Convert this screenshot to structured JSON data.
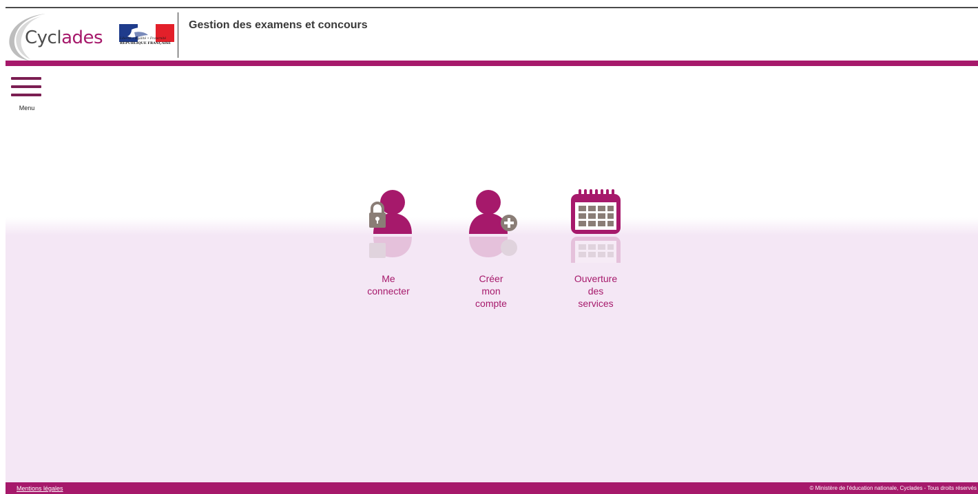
{
  "header": {
    "logo_prefix": "Cycl",
    "logo_accent": "ades",
    "motto": "Liberté • Égalité • Fraternité",
    "republic": "RÉPUBLIQUE FRANÇAISE",
    "app_title": "Gestion des examens et concours"
  },
  "menu": {
    "label": "Menu"
  },
  "tiles": [
    {
      "label_lines": [
        "Me",
        "connecter"
      ],
      "icon": "user-lock-icon"
    },
    {
      "label_lines": [
        "Créer",
        "mon",
        "compte"
      ],
      "icon": "user-add-icon"
    },
    {
      "label_lines": [
        "Ouverture",
        "des",
        "services"
      ],
      "icon": "calendar-icon"
    }
  ],
  "footer": {
    "legal_link": "Mentions légales",
    "copyright": "© Ministère de l'éducation nationale, Cyclades - Tous droits réservés"
  },
  "colors": {
    "accent": "#a6196b",
    "menu_icon": "#7b1e52",
    "pale_background": "#f4e7f5",
    "icon_grey": "#8a7d76"
  }
}
